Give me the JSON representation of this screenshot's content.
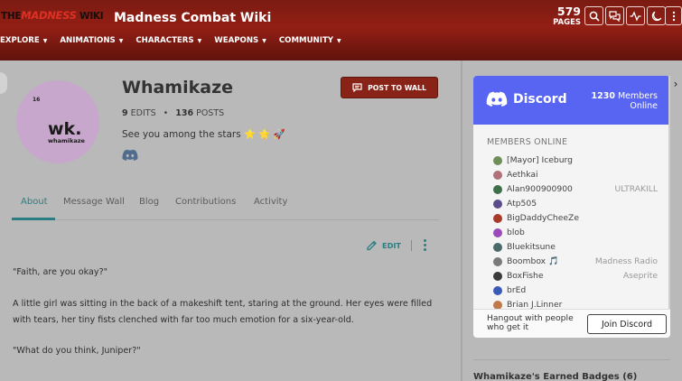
{
  "header": {
    "logo_text_1": "THE",
    "logo_text_2": "MADNESS",
    "logo_text_3": "WIKI",
    "wiki_name": "Madness Combat Wiki",
    "pages_count": "579",
    "pages_label": "PAGES",
    "nav": [
      {
        "label": "EXPLORE"
      },
      {
        "label": "ANIMATIONS"
      },
      {
        "label": "CHARACTERS"
      },
      {
        "label": "WEAPONS"
      },
      {
        "label": "COMMUNITY"
      }
    ],
    "icons": [
      "search-icon",
      "discussions-icon",
      "activity-icon",
      "theme-moon-icon",
      "more-icon"
    ]
  },
  "profile": {
    "avatar_small": "16",
    "avatar_big": "wk.",
    "avatar_sub": "whamikaze",
    "username": "Whamikaze",
    "edits": "9",
    "edits_label": "EDITS",
    "posts": "136",
    "posts_label": "POSTS",
    "bio": "See you among the stars ⭐ 🌟 🚀",
    "post_to_wall": "POST TO WALL"
  },
  "tabs": [
    {
      "label": "About"
    },
    {
      "label": "Message Wall"
    },
    {
      "label": "Blog"
    },
    {
      "label": "Contributions"
    },
    {
      "label": "Activity"
    }
  ],
  "edit_label": "EDIT",
  "content": {
    "p1": "\"Faith, are you okay?\"",
    "p2": "A little girl was sitting in the back of a makeshift tent, staring at the ground. Her eyes were filled with tears, her tiny fists clenched with far too much emotion for a six-year-old.",
    "p3": "\"What do you think, Juniper?\""
  },
  "discord": {
    "brand": "Discord",
    "count": "1230",
    "count_label_1": "Members",
    "count_label_2": "Online",
    "members_title": "MEMBERS ONLINE",
    "members": [
      {
        "name": "[Mayor] Iceburg",
        "game": "",
        "color": "#6f8f5a"
      },
      {
        "name": "Aethkai",
        "game": "",
        "color": "#b0707a"
      },
      {
        "name": "Alan900900900",
        "game": "ULTRAKILL",
        "color": "#3e6f4a"
      },
      {
        "name": "Atp505",
        "game": "",
        "color": "#5a4c8a"
      },
      {
        "name": "BigDaddyCheeZe",
        "game": "",
        "color": "#a83a2a"
      },
      {
        "name": "blob",
        "game": "",
        "color": "#9a4ab8"
      },
      {
        "name": "Bluekitsune",
        "game": "",
        "color": "#4a6a6a"
      },
      {
        "name": "Boombox 🎵",
        "game": "Madness Radio",
        "color": "#7a7a7a"
      },
      {
        "name": "BoxFishe",
        "game": "Aseprite",
        "color": "#3a3a3a"
      },
      {
        "name": "brEd",
        "game": "",
        "color": "#3a5ab8"
      },
      {
        "name": "Brian J.Linner",
        "game": "",
        "color": "#c07a4a"
      }
    ],
    "footer_text": "Hangout with people who get it",
    "join": "Join Discord"
  },
  "badges_title": "Whamikaze's Earned Badges (6)"
}
